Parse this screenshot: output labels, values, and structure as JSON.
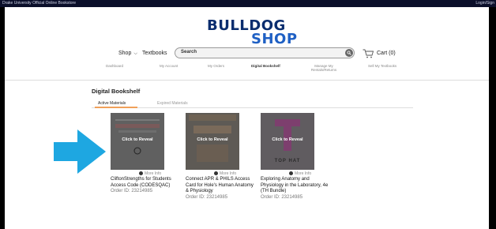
{
  "top_bar": {
    "left_text": "Drake University Official Online Bookstore",
    "right_text": "Login/Sign"
  },
  "logo": {
    "line1": "BULLDOG",
    "line2": "SHOP"
  },
  "nav": {
    "shop": "Shop",
    "textbooks": "Textbooks",
    "search_placeholder": "Search",
    "cart": "Cart (0)"
  },
  "account_tabs": [
    "Dashboard",
    "My Account",
    "My Orders",
    "Digital Bookshelf",
    "Manage My Rentals/Returns",
    "Sell My Textbooks"
  ],
  "heading": "Digital Bookshelf",
  "subtabs": {
    "active": "Active Materials",
    "expired": "Expired Materials"
  },
  "cards": [
    {
      "reveal": "Click to Reveal",
      "more": "More Info",
      "title": "CliftonStrengths for Students Access Code (CODESQAC)",
      "order": "Order ID: 23214985"
    },
    {
      "reveal": "Click to Reveal",
      "more": "More Info",
      "title": "Connect APR & PHILS Access Card for Hole's Human Anatomy & Physiology",
      "order": "Order ID: 23214985"
    },
    {
      "reveal": "Click to Reveal",
      "more": "More Info",
      "title": "Exploring Anatomy and Physiology in the Laboratory, 4e (TH Bundle)",
      "order": "Order ID: 23214985",
      "cover_text": "TOP HAT"
    }
  ],
  "colors": {
    "accent_blue": "#1ea7e1",
    "brand_navy": "#0a2d6e",
    "tab_underline": "#f0a05a"
  }
}
